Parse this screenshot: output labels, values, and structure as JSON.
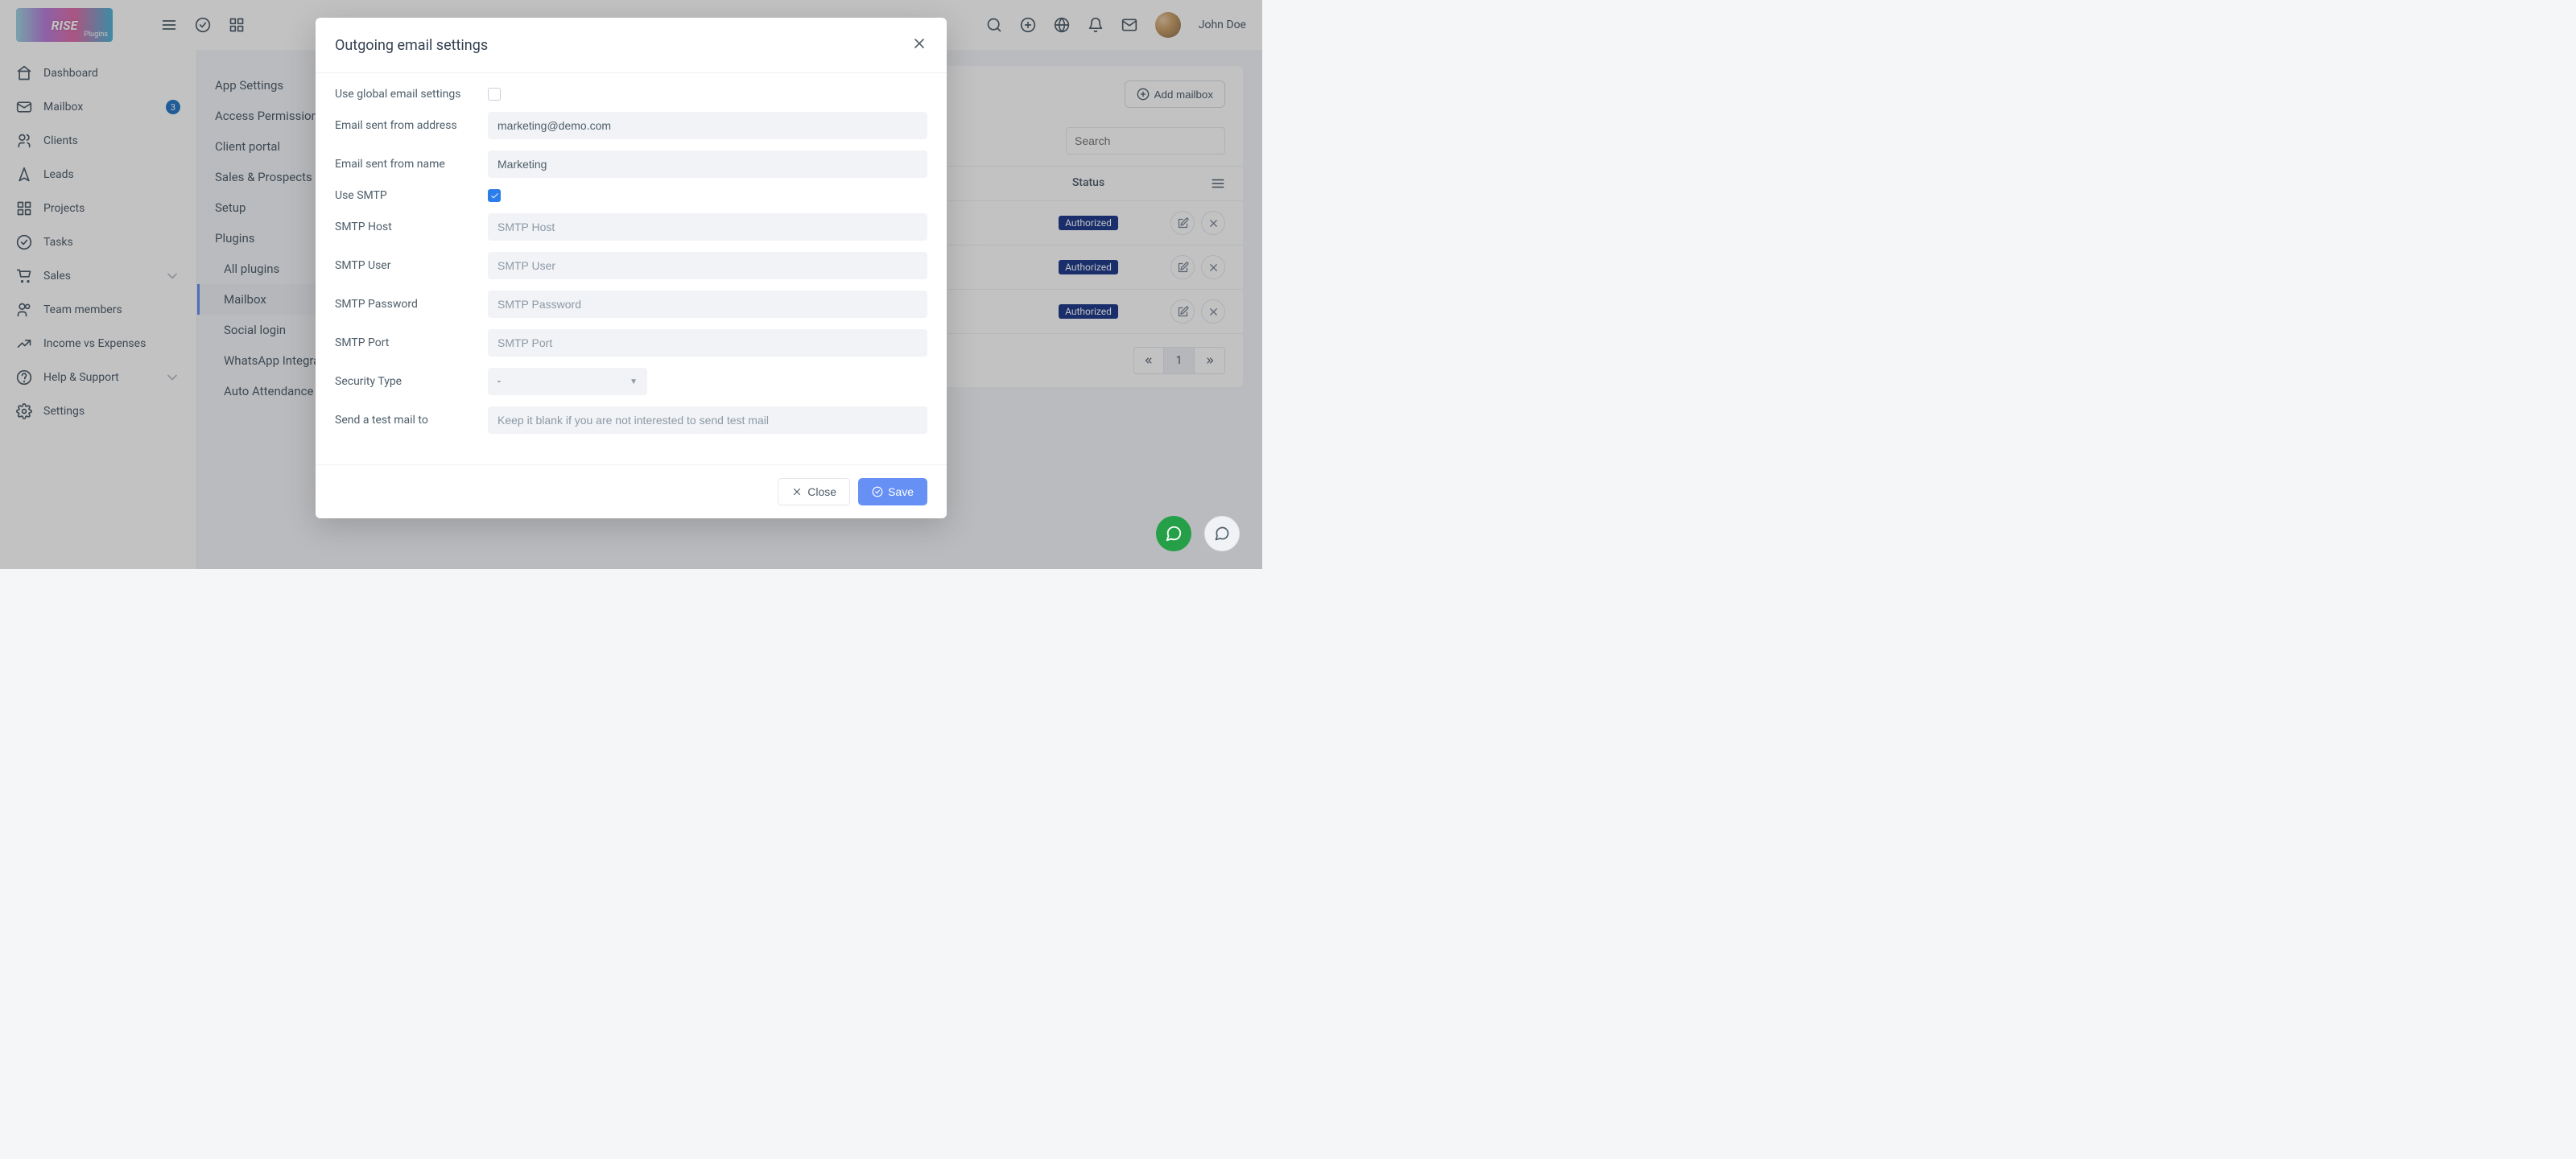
{
  "brand": {
    "name": "RISE",
    "sub": "Plugins"
  },
  "user": {
    "name": "John Doe"
  },
  "nav": {
    "dashboard": "Dashboard",
    "mailbox": "Mailbox",
    "mailbox_badge": "3",
    "clients": "Clients",
    "leads": "Leads",
    "projects": "Projects",
    "tasks": "Tasks",
    "sales": "Sales",
    "team": "Team members",
    "income": "Income vs Expenses",
    "help": "Help & Support",
    "settings": "Settings"
  },
  "secondary": {
    "app_settings": "App Settings",
    "access": "Access Permission",
    "client_portal": "Client portal",
    "sales_prospects": "Sales & Prospects",
    "setup": "Setup",
    "plugins": "Plugins",
    "all_plugins": "All plugins",
    "mailbox": "Mailbox",
    "social_login": "Social login",
    "whatsapp": "WhatsApp Integration",
    "auto_attendance": "Auto Attendance"
  },
  "list": {
    "add_mailbox": "Add mailbox",
    "search_placeholder": "Search",
    "status_header": "Status",
    "status_badge": "Authorized",
    "page": "1"
  },
  "modal": {
    "title": "Outgoing email settings",
    "labels": {
      "use_global": "Use global email settings",
      "from_address": "Email sent from address",
      "from_name": "Email sent from name",
      "use_smtp": "Use SMTP",
      "smtp_host": "SMTP Host",
      "smtp_user": "SMTP User",
      "smtp_password": "SMTP Password",
      "smtp_port": "SMTP Port",
      "security_type": "Security Type",
      "test_mail": "Send a test mail to"
    },
    "values": {
      "from_address": "marketing@demo.com",
      "from_name": "Marketing",
      "use_global_checked": false,
      "use_smtp_checked": true,
      "security_type": "-"
    },
    "placeholders": {
      "smtp_host": "SMTP Host",
      "smtp_user": "SMTP User",
      "smtp_password": "SMTP Password",
      "smtp_port": "SMTP Port",
      "test_mail": "Keep it blank if you are not interested to send test mail"
    },
    "buttons": {
      "close": "Close",
      "save": "Save"
    }
  }
}
